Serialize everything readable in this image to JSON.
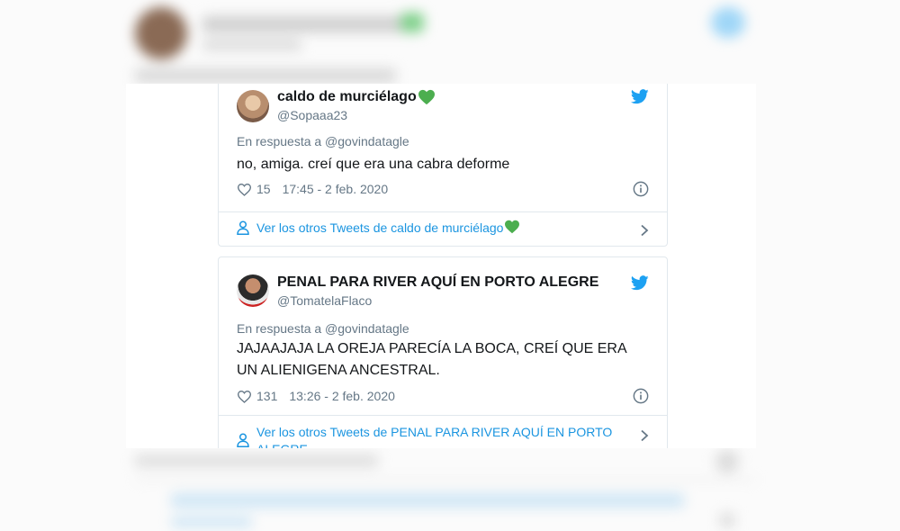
{
  "background_tweet": {
    "blurred": true
  },
  "tweets": [
    {
      "display_name": "caldo de murciélago",
      "handle": "@Sopaaa23",
      "reply_to": "En respuesta a @govindatagle",
      "text": "no, amiga. creí que era una cabra deforme",
      "likes": "15",
      "timestamp": "17:45 - 2 feb. 2020",
      "more_link": "Ver los otros Tweets de caldo de murciélago"
    },
    {
      "display_name": "PENAL PARA RIVER AQUÍ EN PORTO ALEGRE",
      "handle": "@TomatelaFlaco",
      "reply_to": "En respuesta a @govindatagle",
      "text": "JAJAAJAJA LA OREJA PARECÍA LA BOCA, CREÍ QUE ERA UN ALIENIGENA ANCESTRAL.",
      "likes": "131",
      "timestamp": "13:26 - 2 feb. 2020",
      "more_link": "Ver los otros Tweets de PENAL PARA RIVER AQUÍ EN PORTO ALEGRE"
    }
  ],
  "icons": {
    "twitter_bird": "twitter-bird-icon",
    "like": "heart-outline-icon",
    "info": "info-circle-icon",
    "profile": "person-icon",
    "chevron": "chevron-right-icon",
    "emoji": "green-heart-emoji"
  },
  "colors": {
    "twitter_blue": "#1da1f2",
    "link_blue": "#1b95e0",
    "secondary_text": "#657786",
    "green_heart": "#4cae4f",
    "border": "#e1e8ed"
  }
}
